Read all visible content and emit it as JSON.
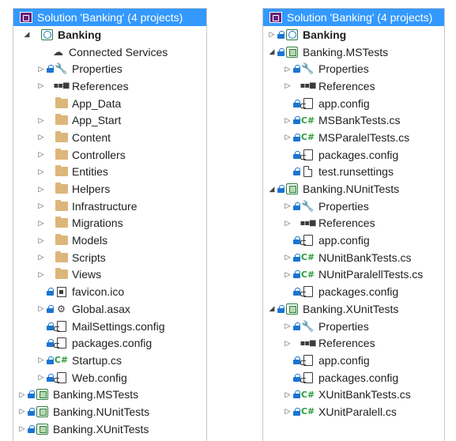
{
  "colors": {
    "selection_bg": "#3399ff",
    "selection_text": "#ffffff",
    "lock_blue": "#1b75d0",
    "folder_tan": "#dcb67a",
    "csharp_green": "#2a9d3a"
  },
  "left": {
    "solution_title": "Solution 'Banking' (4 projects)",
    "items": [
      {
        "label": "Banking",
        "icon": "web-project-icon"
      },
      {
        "label": "Connected Services",
        "icon": "connected-services-icon"
      },
      {
        "label": "Properties",
        "icon": "wrench-icon"
      },
      {
        "label": "References",
        "icon": "references-icon"
      },
      {
        "label": "App_Data",
        "icon": "folder-icon"
      },
      {
        "label": "App_Start",
        "icon": "folder-icon"
      },
      {
        "label": "Content",
        "icon": "folder-icon"
      },
      {
        "label": "Controllers",
        "icon": "folder-icon"
      },
      {
        "label": "Entities",
        "icon": "folder-icon"
      },
      {
        "label": "Helpers",
        "icon": "folder-icon"
      },
      {
        "label": "Infrastructure",
        "icon": "folder-icon"
      },
      {
        "label": "Migrations",
        "icon": "folder-icon"
      },
      {
        "label": "Models",
        "icon": "folder-icon"
      },
      {
        "label": "Scripts",
        "icon": "folder-icon"
      },
      {
        "label": "Views",
        "icon": "folder-icon"
      },
      {
        "label": "favicon.ico",
        "icon": "image-file-icon"
      },
      {
        "label": "Global.asax",
        "icon": "asax-file-icon"
      },
      {
        "label": "MailSettings.config",
        "icon": "config-file-icon"
      },
      {
        "label": "packages.config",
        "icon": "config-file-icon"
      },
      {
        "label": "Startup.cs",
        "icon": "csharp-file-icon"
      },
      {
        "label": "Web.config",
        "icon": "config-file-icon"
      },
      {
        "label": "Banking.MSTests",
        "icon": "test-project-icon"
      },
      {
        "label": "Banking.NUnitTests",
        "icon": "test-project-icon"
      },
      {
        "label": "Banking.XUnitTests",
        "icon": "test-project-icon"
      }
    ]
  },
  "right": {
    "solution_title": "Solution 'Banking' (4 projects)",
    "items": [
      {
        "label": "Banking",
        "icon": "web-project-icon"
      },
      {
        "label": "Banking.MSTests",
        "icon": "test-project-icon"
      },
      {
        "label": "Properties",
        "icon": "wrench-icon"
      },
      {
        "label": "References",
        "icon": "references-icon"
      },
      {
        "label": "app.config",
        "icon": "config-file-icon"
      },
      {
        "label": "MSBankTests.cs",
        "icon": "csharp-file-icon"
      },
      {
        "label": "MSParalelTests.cs",
        "icon": "csharp-file-icon"
      },
      {
        "label": "packages.config",
        "icon": "config-file-icon"
      },
      {
        "label": "test.runsettings",
        "icon": "file-icon"
      },
      {
        "label": "Banking.NUnitTests",
        "icon": "test-project-icon"
      },
      {
        "label": "Properties",
        "icon": "wrench-icon"
      },
      {
        "label": "References",
        "icon": "references-icon"
      },
      {
        "label": "app.config",
        "icon": "config-file-icon"
      },
      {
        "label": "NUnitBankTests.cs",
        "icon": "csharp-file-icon"
      },
      {
        "label": "NUnitParalellTests.cs",
        "icon": "csharp-file-icon"
      },
      {
        "label": "packages.config",
        "icon": "config-file-icon"
      },
      {
        "label": "Banking.XUnitTests",
        "icon": "test-project-icon"
      },
      {
        "label": "Properties",
        "icon": "wrench-icon"
      },
      {
        "label": "References",
        "icon": "references-icon"
      },
      {
        "label": "app.config",
        "icon": "config-file-icon"
      },
      {
        "label": "packages.config",
        "icon": "config-file-icon"
      },
      {
        "label": "XUnitBankTests.cs",
        "icon": "csharp-file-icon"
      },
      {
        "label": "XUnitParalell.cs",
        "icon": "csharp-file-icon"
      }
    ]
  }
}
